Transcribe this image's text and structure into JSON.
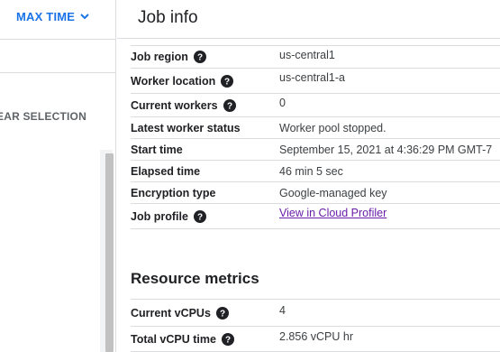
{
  "left_panel": {
    "time_range_label": "MAX TIME",
    "clear_selection_label": "EAR SELECTION"
  },
  "header": {
    "title": "Job info"
  },
  "job_info": {
    "rows": [
      {
        "label": "Job region",
        "value": "us-central1",
        "help": true
      },
      {
        "label": "Worker location",
        "value": "us-central1-a",
        "help": true
      },
      {
        "label": "Current workers",
        "value": "0",
        "help": true
      },
      {
        "label": "Latest worker status",
        "value": "Worker pool stopped.",
        "help": false
      },
      {
        "label": "Start time",
        "value": "September 15, 2021 at 4:36:29 PM GMT-7",
        "help": false
      },
      {
        "label": "Elapsed time",
        "value": "46 min 5 sec",
        "help": false
      },
      {
        "label": "Encryption type",
        "value": "Google-managed key",
        "help": false
      },
      {
        "label": "Job profile",
        "value": "View in Cloud Profiler",
        "help": true,
        "link": true
      }
    ]
  },
  "resource_metrics": {
    "title": "Resource metrics",
    "rows": [
      {
        "label": "Current vCPUs",
        "value": "4",
        "help": true
      },
      {
        "label": "Total vCPU time",
        "value": "2.856 vCPU hr",
        "help": true
      }
    ]
  },
  "colors": {
    "accent": "#1a73e8",
    "link_visited": "#681da8",
    "divider": "#dadce0"
  }
}
